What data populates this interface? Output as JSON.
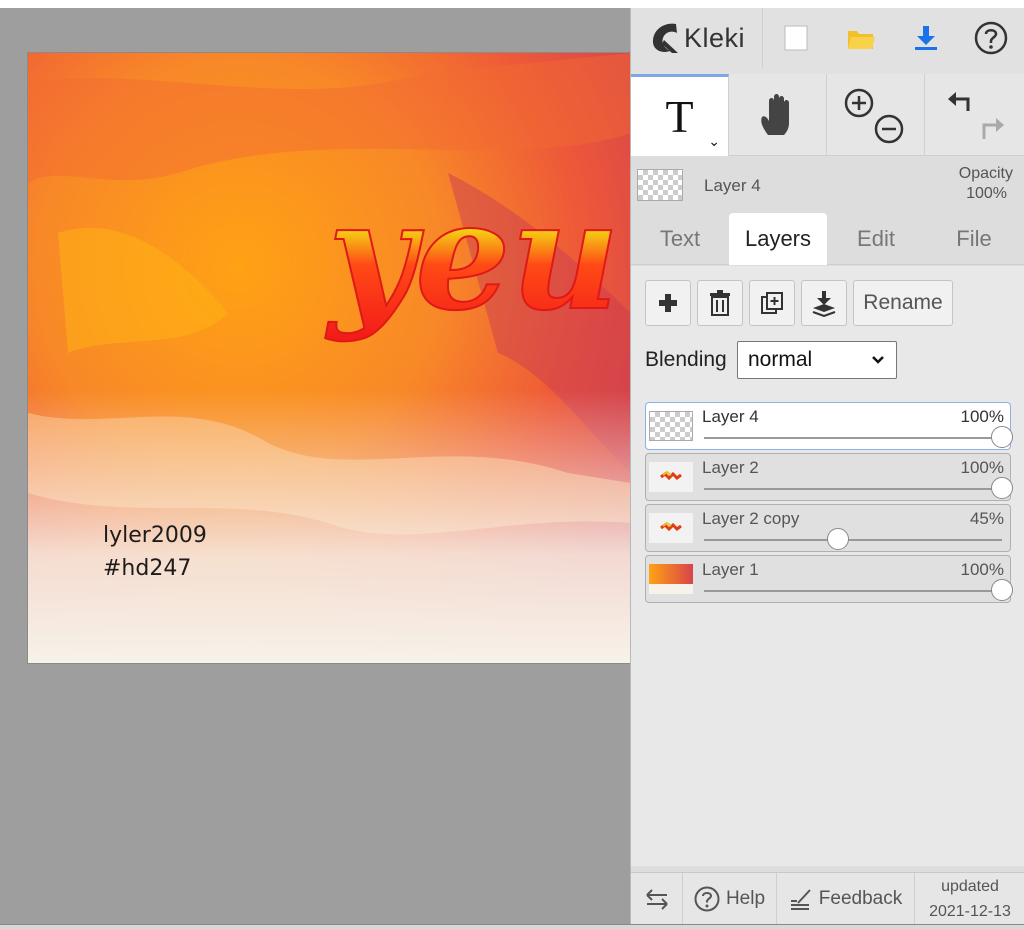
{
  "canvas": {
    "artwork_text": "yeu",
    "credit_line1": "lyler2009",
    "credit_line2": "#hd247"
  },
  "header": {
    "app_name": "Kleki",
    "buttons": [
      {
        "name": "new-image",
        "icon": "blank-page-icon"
      },
      {
        "name": "open-file",
        "icon": "folder-icon"
      },
      {
        "name": "save",
        "icon": "download-icon",
        "color": "#1a73e8"
      },
      {
        "name": "help",
        "icon": "question-mark-icon"
      }
    ]
  },
  "toolbar": {
    "active_tool_label": "T",
    "tools": [
      "text-tool",
      "hand-tool",
      "zoom-tool",
      "undo-redo"
    ]
  },
  "current_layer": {
    "name": "Layer 4",
    "opacity_label": "Opacity",
    "opacity_value": "100%"
  },
  "tabs": [
    {
      "label": "Text",
      "active": false
    },
    {
      "label": "Layers",
      "active": true
    },
    {
      "label": "Edit",
      "active": false
    },
    {
      "label": "File",
      "active": false
    }
  ],
  "layers_panel": {
    "rename_label": "Rename",
    "blending_label": "Blending",
    "blending_value": "normal",
    "layers": [
      {
        "name": "Layer 4",
        "opacity": "100%",
        "opacity_fraction": 1.0,
        "selected": true
      },
      {
        "name": "Layer 2",
        "opacity": "100%",
        "opacity_fraction": 1.0,
        "selected": false
      },
      {
        "name": "Layer 2 copy",
        "opacity": "45%",
        "opacity_fraction": 0.45,
        "selected": false
      },
      {
        "name": "Layer 1",
        "opacity": "100%",
        "opacity_fraction": 1.0,
        "selected": false
      }
    ]
  },
  "footer": {
    "help_label": "Help",
    "feedback_label": "Feedback",
    "updated_label": "updated",
    "updated_date": "2021-12-13"
  },
  "colors": {
    "accent": "#7da7e6",
    "panel_bg": "#dddddd",
    "canvas_bg": "#9e9e9e"
  }
}
